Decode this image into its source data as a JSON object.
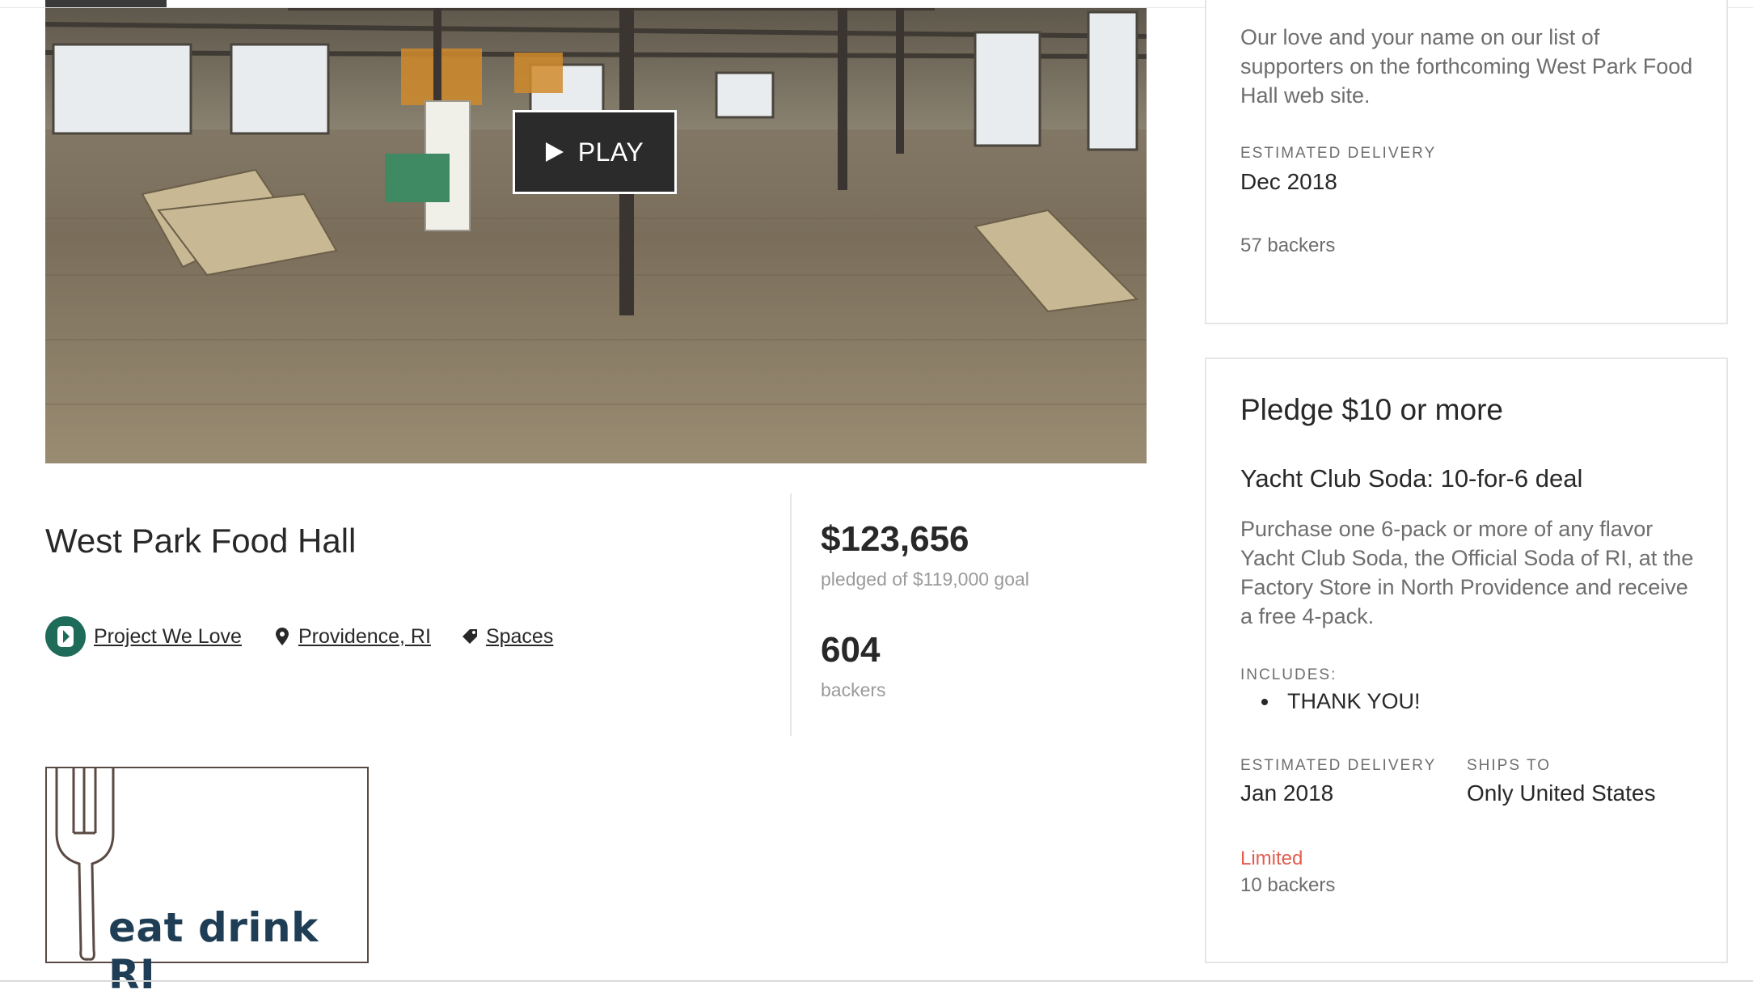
{
  "video": {
    "play_label": "PLAY"
  },
  "project": {
    "title": "West Park Food Hall",
    "badge_label": "Project We Love",
    "location": "Providence, RI",
    "category": "Spaces"
  },
  "stats": {
    "pledged": "$123,656",
    "pledged_sub": "pledged of $119,000 goal",
    "backers": "604",
    "backers_sub": "backers"
  },
  "logo": {
    "text": "eat drink RI"
  },
  "rewards": [
    {
      "description": "Our love and your name on our list of supporters on the forthcoming West Park Food Hall web site.",
      "delivery_label": "ESTIMATED DELIVERY",
      "delivery": "Dec 2018",
      "backers": "57 backers"
    },
    {
      "pledge": "Pledge $10 or more",
      "title": "Yacht Club Soda: 10-for-6 deal",
      "description": "Purchase one 6-pack or more of any flavor Yacht Club Soda, the Official Soda of RI, at the Factory Store in North Providence and receive a free 4-pack.",
      "includes_label": "INCLUDES:",
      "includes": [
        "THANK YOU!"
      ],
      "delivery_label": "ESTIMATED DELIVERY",
      "delivery": "Jan 2018",
      "ships_label": "SHIPS TO",
      "ships": "Only United States",
      "limited": "Limited",
      "backers": "10 backers"
    }
  ],
  "colors": {
    "accent_green": "#1f6b5a",
    "limited_red": "#e35d4f",
    "text_dark": "#282828",
    "text_muted": "#6e6e6e"
  }
}
